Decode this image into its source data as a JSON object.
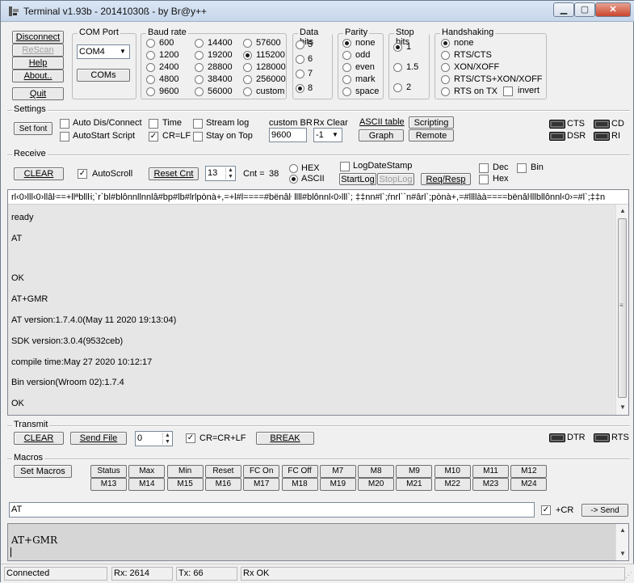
{
  "window": {
    "title": "Terminal v1.93b - 20141030ß - by Br@y++",
    "min_glyph": "▁",
    "max_glyph": "▢",
    "close_glyph": "✕"
  },
  "conn": {
    "disconnect": "Disconnect",
    "rescan": "ReScan",
    "help": "Help",
    "about": "About..",
    "quit": "Quit"
  },
  "comport": {
    "title": "COM Port",
    "value": "COM4",
    "coms": "COMs"
  },
  "baud": {
    "title": "Baud rate",
    "options": [
      "600",
      "1200",
      "2400",
      "4800",
      "9600",
      "14400",
      "19200",
      "28800",
      "38400",
      "56000",
      "57600",
      "115200",
      "128000",
      "256000",
      "custom"
    ],
    "selected": "115200"
  },
  "databits": {
    "title": "Data bits",
    "options": [
      "5",
      "6",
      "7",
      "8"
    ],
    "selected": "8"
  },
  "parity": {
    "title": "Parity",
    "options": [
      "none",
      "odd",
      "even",
      "mark",
      "space"
    ],
    "selected": "none"
  },
  "stopbits": {
    "title": "Stop bits",
    "options": [
      "1",
      "1.5",
      "2"
    ],
    "selected": "1"
  },
  "handshaking": {
    "title": "Handshaking",
    "options": [
      "none",
      "RTS/CTS",
      "XON/XOFF",
      "RTS/CTS+XON/XOFF",
      "RTS on TX"
    ],
    "invert": "invert",
    "selected": "none"
  },
  "settings": {
    "title": "Settings",
    "set_font": "Set font",
    "auto_dis": "Auto Dis/Connect",
    "autostart": "AutoStart Script",
    "time": "Time",
    "crlf": "CR=LF",
    "stream_log": "Stream log",
    "stay_on_top": "Stay on Top",
    "custom_br_label": "custom BR",
    "custom_br_value": "9600",
    "rx_clear_label": "Rx Clear",
    "rx_clear_value": "-1",
    "ascii_table": "ASCII table",
    "graph": "Graph",
    "scripting": "Scripting",
    "remote": "Remote",
    "cts": "CTS",
    "cd": "CD",
    "dsr": "DSR",
    "ri": "RI"
  },
  "receive": {
    "title": "Receive",
    "clear": "CLEAR",
    "autoscroll": "AutoScroll",
    "reset_cnt": "Reset Cnt",
    "cnt_spin": "13",
    "cnt_label": "Cnt =",
    "cnt_value": "38",
    "hex": "HEX",
    "ascii": "ASCII",
    "logdatestamp": "LogDateStamp",
    "startlog": "StartLog",
    "stoplog": "StopLog",
    "reqresp": "Req/Resp",
    "dec": "Dec",
    "bin": "Bin",
    "hexchk": "Hex"
  },
  "output": {
    "lines": [
      "rl‹0›lll‹0›llâŀ==+llªbllŀi;`r`bl#blônnllnnlâ#bp#lb#lrlpònà+,=+l#l====#bënâŀ llll#blônnl‹0›lll`; ‡‡nn#l`;ŕnrl``n#ârl`;pònà+,=#llllàà====bënâŀlllbllônnl‹0›=#l`;‡‡n",
      "ready",
      "AT",
      "",
      "OK",
      "AT+GMR",
      "AT version:1.7.4.0(May 11 2020 19:13:04)",
      "SDK version:3.0.4(9532ceb)",
      "compile time:May 27 2020 10:12:17",
      "Bin version(Wroom 02):1.7.4",
      "OK"
    ]
  },
  "transmit": {
    "title": "Transmit",
    "clear": "CLEAR",
    "send_file": "Send File",
    "spin": "0",
    "crcrlf": "CR=CR+LF",
    "break": "BREAK",
    "dtr": "DTR",
    "rts": "RTS"
  },
  "macros": {
    "title": "Macros",
    "set_macros": "Set Macros",
    "row1": [
      "Status",
      "Max",
      "Min",
      "Reset",
      "FC On",
      "FC Off",
      "M7",
      "M8",
      "M9",
      "M10",
      "M11",
      "M12"
    ],
    "row2": [
      "M13",
      "M14",
      "M15",
      "M16",
      "M17",
      "M18",
      "M19",
      "M20",
      "M21",
      "M22",
      "M23",
      "M24"
    ]
  },
  "input": {
    "value": "AT",
    "cr": "+CR",
    "send": "-> Send"
  },
  "txlog": {
    "text": "AT+GMR"
  },
  "status": {
    "state": "Connected",
    "rx": "Rx: 2614",
    "tx": "Tx: 66",
    "rxok": "Rx OK"
  }
}
